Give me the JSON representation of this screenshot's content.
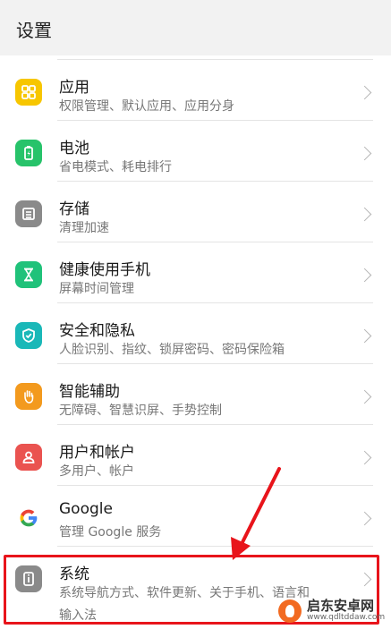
{
  "header": {
    "title": "设置"
  },
  "items": [
    {
      "label": "应用",
      "desc": "权限管理、默认应用、应用分身",
      "icon": "apps-icon",
      "color": "#f7c600"
    },
    {
      "label": "电池",
      "desc": "省电模式、耗电排行",
      "icon": "battery-icon",
      "color": "#27c36a"
    },
    {
      "label": "存储",
      "desc": "清理加速",
      "icon": "storage-icon",
      "color": "#8a8a8a"
    },
    {
      "label": "健康使用手机",
      "desc": "屏幕时间管理",
      "icon": "hourglass-icon",
      "color": "#20c27a"
    },
    {
      "label": "安全和隐私",
      "desc": "人脸识别、指纹、锁屏密码、密码保险箱",
      "icon": "shield-icon",
      "color": "#1ab8b8"
    },
    {
      "label": "智能辅助",
      "desc": "无障碍、智慧识屏、手势控制",
      "icon": "hand-icon",
      "color": "#f39a1e"
    },
    {
      "label": "用户和帐户",
      "desc": "多用户、帐户",
      "icon": "user-icon",
      "color": "#ea5350"
    },
    {
      "label": "Google",
      "desc": "管理 Google 服务",
      "icon": "google-icon",
      "color": "#4285f4"
    },
    {
      "label": "系统",
      "desc": "系统导航方式、软件更新、关于手机、语言和",
      "desc2": "输入法",
      "icon": "system-icon",
      "color": "#8a8a8a"
    }
  ],
  "watermark": {
    "name": "启东安卓网",
    "url": "www.qdltddaw.com"
  }
}
